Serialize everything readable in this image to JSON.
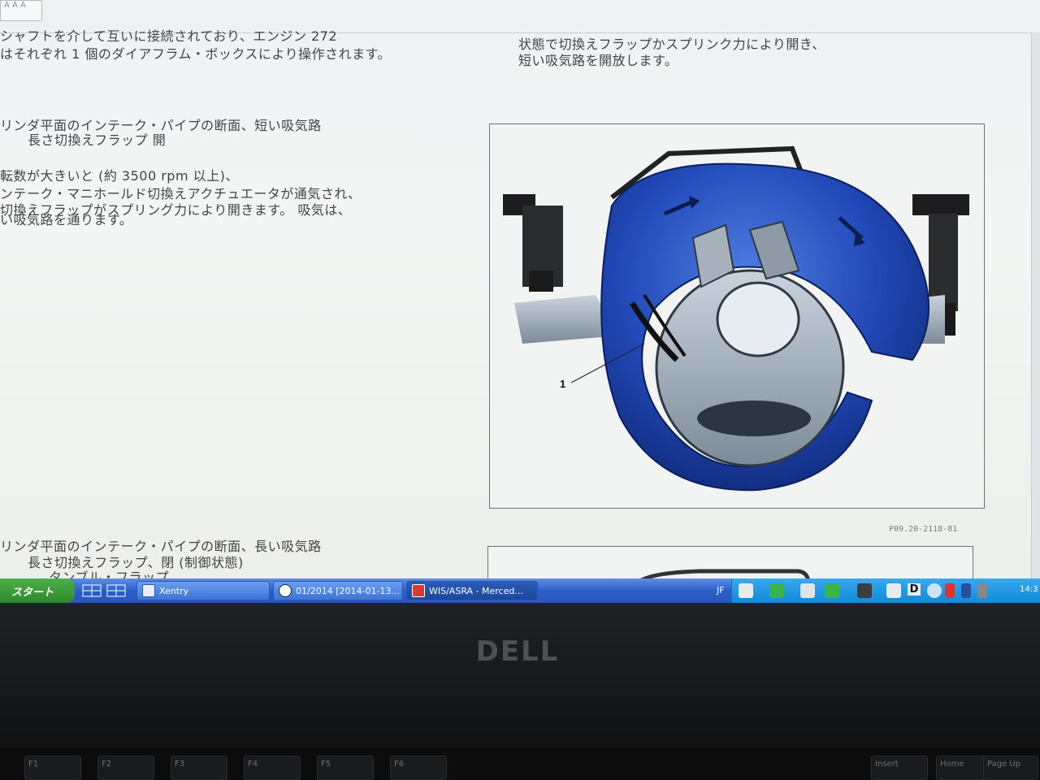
{
  "top_tab_label": "A A A",
  "left_text": {
    "line1": "シャフトを介して互いに接続されており、エンジン 272",
    "line2": "はそれぞれ 1 個のダイアフラム・ボックスにより操作されます。",
    "heading1": "リンダ平面のインテーク・パイプの断面、短い吸気路",
    "sub1": "長さ切換えフラップ 開",
    "p1": "転数が大きいと (約 3500 rpm 以上)、",
    "p2": "ンテーク・マニホールド切換えアクチュエータが通気され、",
    "p3": "切換えフラップがスプリング力により開きます。 吸気は、",
    "p4": "い吸気路を通ります。",
    "heading2": "リンダ平面のインテーク・パイプの断面、長い吸気路",
    "sub2": "長さ切換えフラップ、閉 (制御状態)",
    "sub3": "タンブル・フラップ"
  },
  "right_text": {
    "line1": "状態で切換えフラップかスプリンク力により開き、",
    "line2": "短い吸気路を開放します。"
  },
  "figure": {
    "callout": "1",
    "caption": "P09.20-2118-81"
  },
  "taskbar": {
    "start_label": "スタート",
    "tasks": [
      {
        "label": "Xentry"
      },
      {
        "label": "01/2014 [2014-01-13..."
      },
      {
        "label": "WIS/ASRA - Merced..."
      }
    ],
    "lang": "JF",
    "tray_d": "D",
    "clock": "14:3"
  },
  "laptop": {
    "brand": "DELL",
    "keys": [
      "F1",
      "F2",
      "F3",
      "F4",
      "F5",
      "F6",
      "Insert",
      "Home",
      "Page Up"
    ]
  },
  "colors": {
    "intake_blue": "#1f4fc9",
    "taskbar_blue": "#2a5fc8",
    "start_green": "#2d8a2c",
    "tray_blue": "#0f8ad9"
  }
}
